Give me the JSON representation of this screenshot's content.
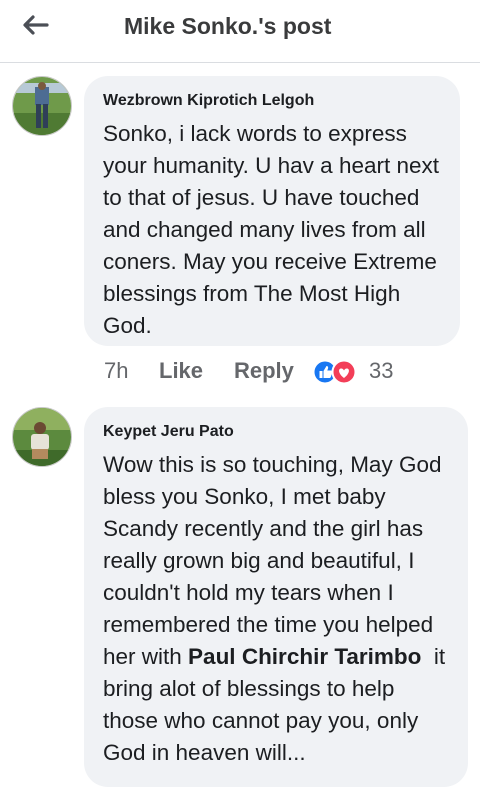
{
  "header": {
    "title": "Mike Sonko.'s post"
  },
  "comments": [
    {
      "author": "Wezbrown Kiprotich Lelgoh",
      "text": "Sonko, i lack words to express your humanity. U hav a heart next to that of jesus. U have touched and changed many lives from all coners. May you receive Extreme blessings from The Most High God.",
      "time": "7h",
      "like_label": "Like",
      "reply_label": "Reply",
      "reaction_count": "33",
      "reaction_icons": [
        "like-icon",
        "love-icon"
      ]
    },
    {
      "author": "Keypet Jeru Pato",
      "text_before": "Wow this is so touching, May God bless you Sonko, I met baby Scandy recently and the girl has really grown big and beautiful, I couldn't hold my tears when I remembered the time you helped her with ",
      "mention": "Paul Chirchir Tarimbo",
      "text_after": "  it bring alot of blessings to help those who cannot pay you, only God in heaven will..."
    }
  ],
  "colors": {
    "bubble": "#f0f2f5",
    "like_blue": "#1877f2",
    "love_red": "#f33e58",
    "meta_gray": "#65676b"
  }
}
